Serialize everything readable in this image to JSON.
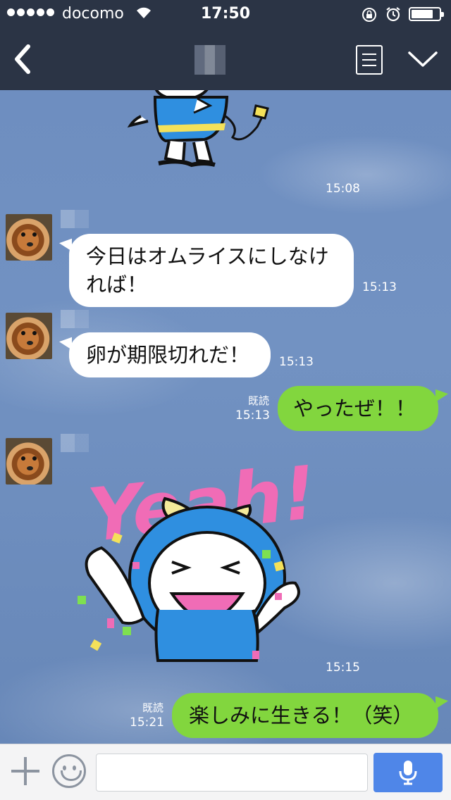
{
  "status_bar": {
    "carrier": "docomo",
    "time": "17:50",
    "signal_bars": 5,
    "battery_level_percent": 70,
    "icons": [
      "signal-dots-icon",
      "wifi-icon",
      "rotation-lock-icon",
      "alarm-icon",
      "battery-icon"
    ]
  },
  "nav": {
    "icons": [
      "back-chevron-icon",
      "contact-avatar-pixelated",
      "notes-list-icon",
      "chevron-down-icon"
    ]
  },
  "messages": [
    {
      "type": "sticker",
      "direction": "in",
      "sticker": "character-plugging-cord",
      "time": "15:08"
    },
    {
      "type": "text",
      "direction": "in",
      "text": "今日はオムライスにしなければ！",
      "time": "15:13"
    },
    {
      "type": "text",
      "direction": "in",
      "text": "卵が期限切れだ！",
      "time": "15:13"
    },
    {
      "type": "text",
      "direction": "out",
      "text": "やったぜ！！",
      "read": "既読",
      "time": "15:13"
    },
    {
      "type": "sticker",
      "direction": "in",
      "sticker": "character-yeah-cheering",
      "sticker_text": "Yeah!",
      "time": "15:15"
    },
    {
      "type": "text",
      "direction": "out",
      "text": "楽しみに生きる！（笑）",
      "read": "既読",
      "time": "15:21"
    }
  ],
  "input_bar": {
    "placeholder": "",
    "icons": [
      "plus-icon",
      "emoji-icon",
      "microphone-icon"
    ],
    "mic_button_color": "#4f86e8"
  },
  "colors": {
    "header": "#2b3445",
    "outgoing_bubble": "#82d63e",
    "incoming_bubble": "#ffffff",
    "chat_background": "#6f8fbf"
  }
}
